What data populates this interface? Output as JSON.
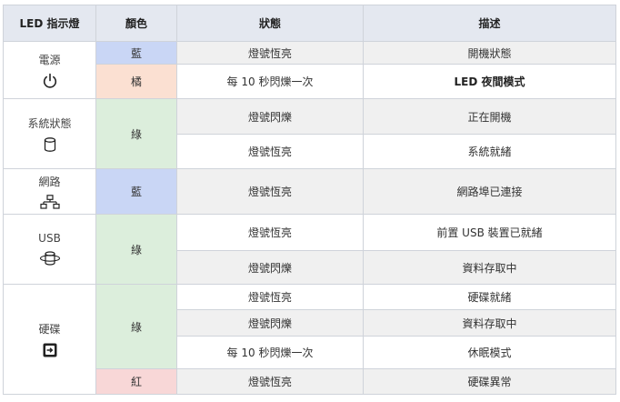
{
  "headers": [
    "LED 指示燈",
    "顏色",
    "狀態",
    "描述"
  ],
  "colors": {
    "header_bg": "#e4e8f0",
    "blue": "#c9d6f5",
    "orange": "#fbe0d2",
    "green": "#dceedc",
    "red": "#f8d7d7",
    "row_grey": "#f0f0f0",
    "row_white": "#ffffff"
  },
  "groups": {
    "power": {
      "label": "電源",
      "icon": "power-icon"
    },
    "system": {
      "label": "系統狀態",
      "icon": "cylinder-icon"
    },
    "network": {
      "label": "網路",
      "icon": "network-icon"
    },
    "usb": {
      "label": "USB",
      "icon": "usb-disk-icon"
    },
    "disk": {
      "label": "硬碟",
      "icon": "hard-drive-icon"
    }
  },
  "rows": [
    {
      "color": "藍",
      "status": "燈號恆亮",
      "desc": "開機狀態"
    },
    {
      "color": "橘",
      "status": "每 10 秒閃爍一次",
      "desc": "LED 夜間模式"
    },
    {
      "color": "綠",
      "status": "燈號閃爍",
      "desc": "正在開機"
    },
    {
      "color": "",
      "status": "燈號恆亮",
      "desc": "系統就緒"
    },
    {
      "color": "藍",
      "status": "燈號恆亮",
      "desc": "網路埠已連接"
    },
    {
      "color": "綠",
      "status": "燈號恆亮",
      "desc": "前置 USB 裝置已就緒"
    },
    {
      "color": "",
      "status": "燈號閃爍",
      "desc": "資料存取中"
    },
    {
      "color": "綠",
      "status": "燈號恆亮",
      "desc": "硬碟就緒"
    },
    {
      "color": "",
      "status": "燈號閃爍",
      "desc": "資料存取中"
    },
    {
      "color": "",
      "status": "每 10 秒閃爍一次",
      "desc": "休眠模式"
    },
    {
      "color": "紅",
      "status": "燈號恆亮",
      "desc": "硬碟異常"
    }
  ]
}
